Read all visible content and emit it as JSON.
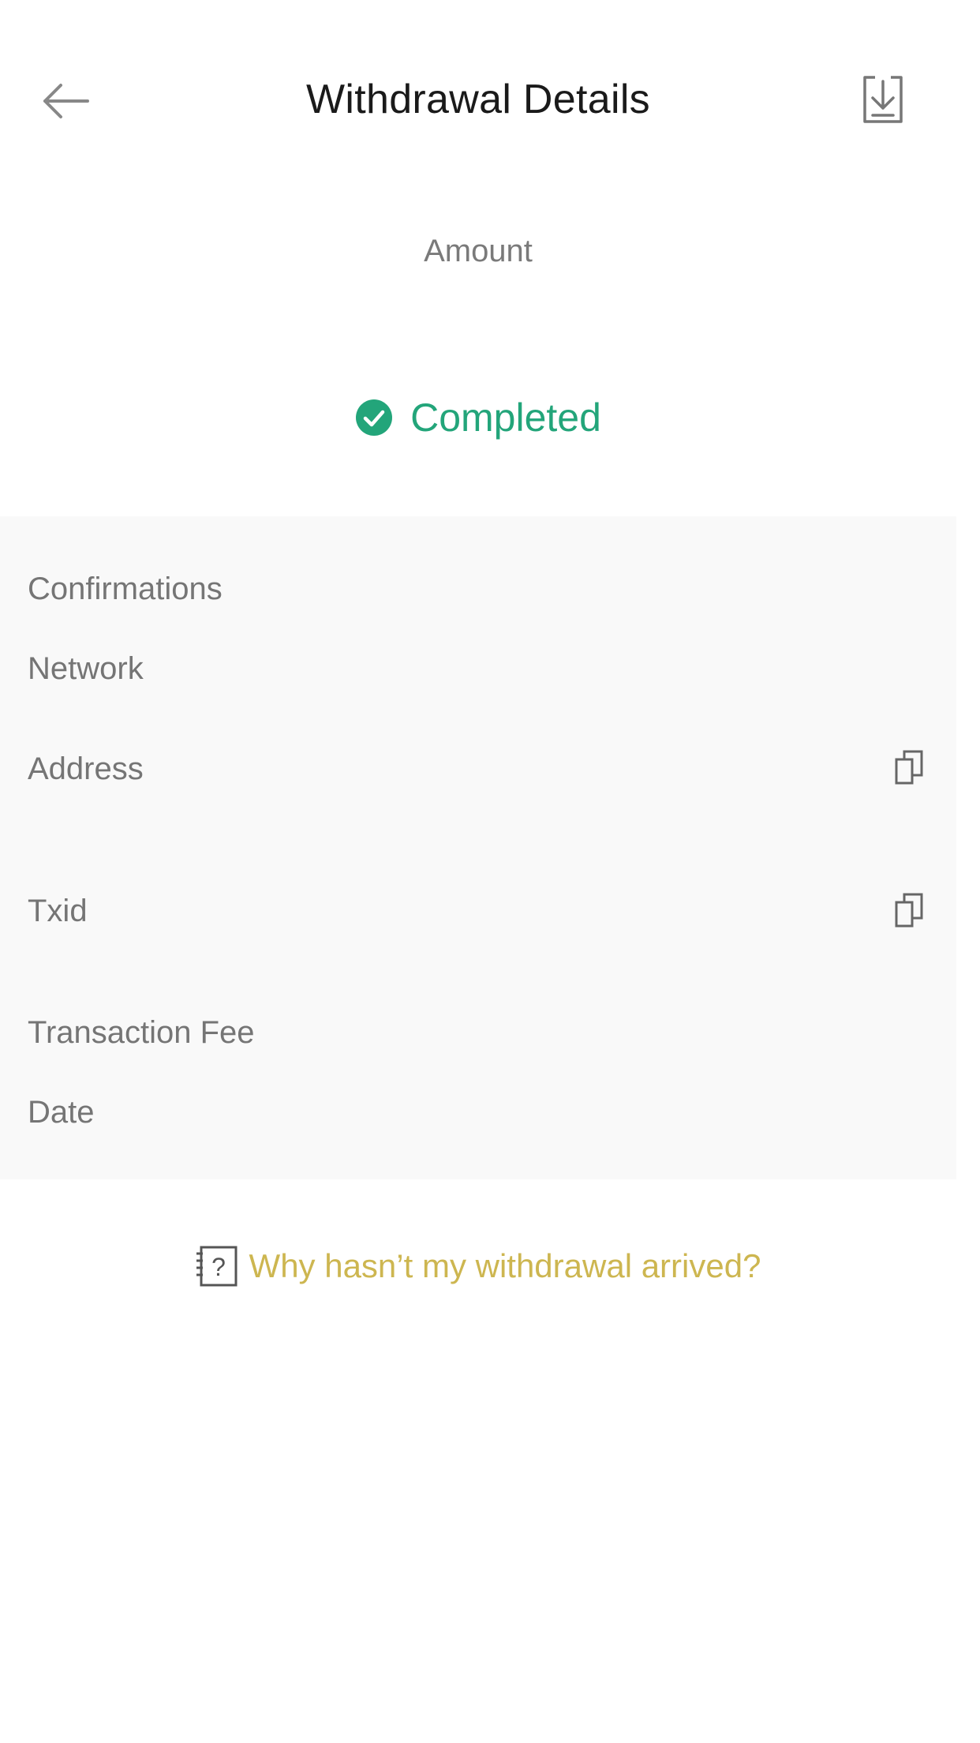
{
  "header": {
    "title": "Withdrawal Details",
    "back_icon": "arrow-left-icon",
    "download_icon": "download-icon"
  },
  "summary": {
    "amount_label": "Amount",
    "status": "Completed",
    "status_icon": "check-circle-icon",
    "status_color": "#23a57a"
  },
  "details": {
    "rows": [
      {
        "label": "Confirmations"
      },
      {
        "label": "Network"
      },
      {
        "label": "Address",
        "copy_icon": "copy-icon"
      },
      {
        "label": "Txid",
        "copy_icon": "copy-icon"
      },
      {
        "label": "Transaction Fee"
      },
      {
        "label": "Date"
      }
    ]
  },
  "help": {
    "label": "Why hasn’t my withdrawal arrived?",
    "icon": "help-document-icon",
    "color": "#cdb650"
  }
}
